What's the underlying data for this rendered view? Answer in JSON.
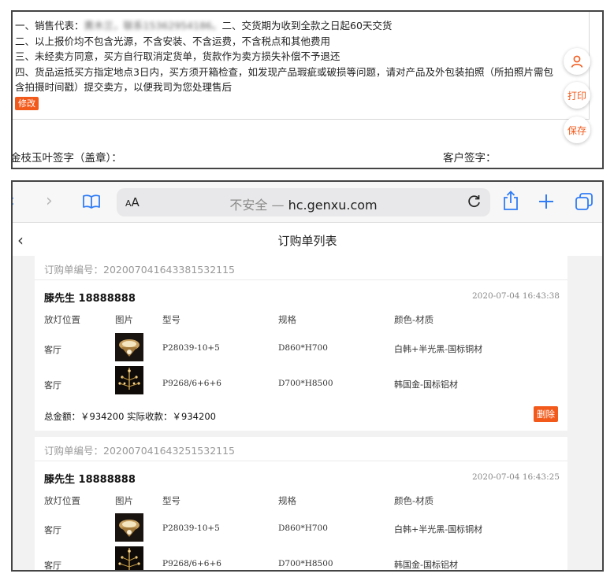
{
  "top": {
    "terms": {
      "line1_prefix": "一、销售代表：",
      "line1_redacted": "黄木兰，联系15362954186。",
      "line1_suffix": "二、交货期为收到全款之日起60天交货",
      "line2": "二、以上报价均不包含光源，不含安装、不含运费，不含税点和其他费用",
      "line3": "三、未经卖方同意，买方自行取消定货单，货款作为卖方损失补偿不予退还",
      "line4": "四、货品运抵买方指定地点3日内，买方须开箱检查，如发现产品瑕疵或破损等问题，请对产品及外包装拍照（所拍照片需包",
      "line5": "含拍摄时间戳）提交卖方，以便我司为您处理售后"
    },
    "edit_label": "修改",
    "print_label": "打印",
    "save_label": "保存",
    "seller_signature": "金枝玉叶签字（盖章）：",
    "customer_signature": "客户签字："
  },
  "browser": {
    "aa_label": "AA",
    "insecure_label": "不安全 —",
    "domain": "hc.genxu.com"
  },
  "app": {
    "title": "订购单列表"
  },
  "table_headers": [
    "放灯位置",
    "图片",
    "型号",
    "规格",
    "颜色-材质"
  ],
  "orders": [
    {
      "order_no": "订购单编号：20200704164338153211​5",
      "customer": "滕先生 18888888",
      "time": "2020-07-04 16:43:38",
      "rows": [
        {
          "location": "客厅",
          "model": "P28039-10+5",
          "spec": "D860*H700",
          "color": "白韩+半光黑-国标铜材"
        },
        {
          "location": "客厅",
          "model": "P9268/6+6+6",
          "spec": "D700*H8500",
          "color": "韩国金-国标铝材"
        }
      ],
      "totals": "总金额：￥934200   实际收款：￥934200",
      "delete_label": "删除"
    },
    {
      "order_no": "订购单编号：20200704164325153211​5",
      "customer": "滕先生 18888888",
      "time": "2020-07-04 16:43:25",
      "rows": [
        {
          "location": "客厅",
          "model": "P28039-10+5",
          "spec": "D860*H700",
          "color": "白韩+半光黑-国标铜材"
        },
        {
          "location": "客厅",
          "model": "P9268/6+6+6",
          "spec": "D700*H8500",
          "color": "韩国金-国标铝材"
        }
      ]
    }
  ]
}
